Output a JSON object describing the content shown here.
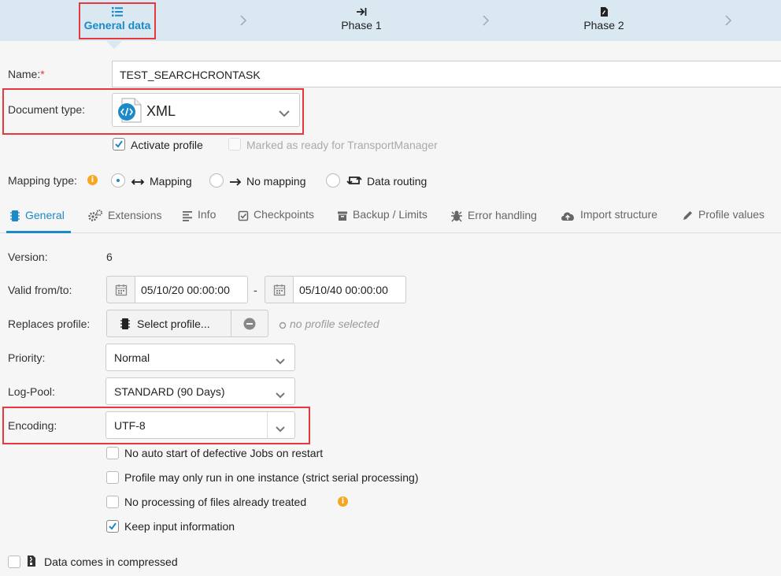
{
  "phases": {
    "general": {
      "label": "General data",
      "icon": "list-icon"
    },
    "phase1": {
      "label": "Phase 1",
      "icon": "arrow-to-right-icon"
    },
    "phase2": {
      "label": "Phase 2",
      "icon": "file-icon"
    }
  },
  "form": {
    "name_label": "Name:",
    "name_required": "*",
    "name_value": "TEST_SEARCHCRONTASK",
    "doctype_label": "Document type:",
    "doctype_value": "XML",
    "activate_label": "Activate profile",
    "transport_label": "Marked as ready for TransportManager",
    "mapping_label": "Mapping type:",
    "mapping_options": [
      "Mapping",
      "No mapping",
      "Data routing"
    ]
  },
  "tabs": [
    "General",
    "Extensions",
    "Info",
    "Checkpoints",
    "Backup / Limits",
    "Error handling",
    "Import structure",
    "Profile values"
  ],
  "general": {
    "version_label": "Version:",
    "version_value": "6",
    "valid_label": "Valid from/to:",
    "valid_from": "05/10/20 00:00:00",
    "valid_sep": "-",
    "valid_to": "05/10/40 00:00:00",
    "replaces_label": "Replaces profile:",
    "select_profile": "Select profile...",
    "no_profile": "no profile selected",
    "priority_label": "Priority:",
    "priority_value": "Normal",
    "logpool_label": "Log-Pool:",
    "logpool_value": "STANDARD (90 Days)",
    "encoding_label": "Encoding:",
    "encoding_value": "UTF-8",
    "options": [
      {
        "label": "No auto start of defective Jobs on restart",
        "checked": false
      },
      {
        "label": "Profile may only run in one instance (strict serial processing)",
        "checked": false
      },
      {
        "label": "No processing of files already treated",
        "checked": false
      },
      {
        "label": "Keep input information",
        "checked": true
      }
    ],
    "compressed_label": "Data comes in compressed"
  },
  "colors": {
    "accent": "#1c8ac8",
    "highlight": "#e4393f",
    "phasebar": "#d9e8f1",
    "info": "#f5a623"
  }
}
